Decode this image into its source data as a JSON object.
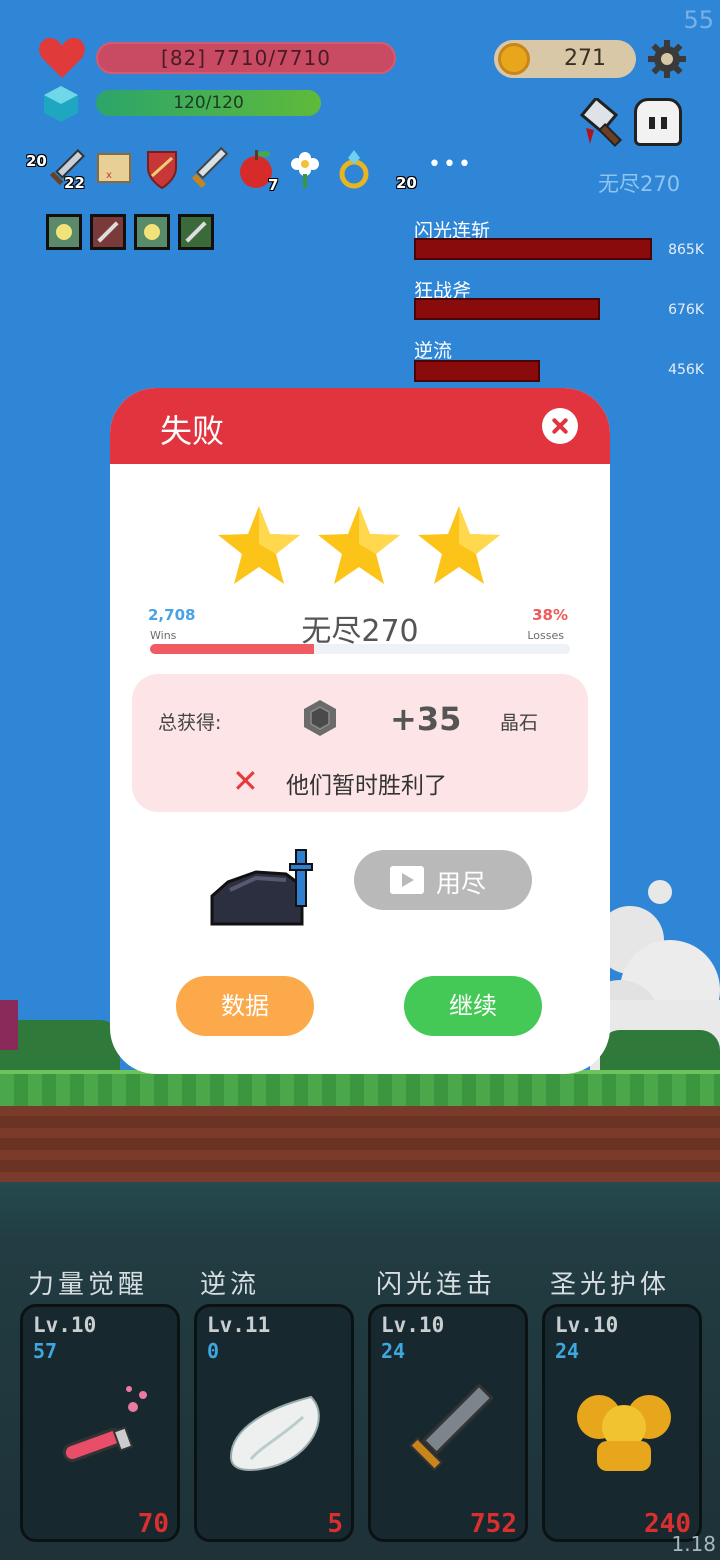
{
  "fps": "55",
  "hud": {
    "hp_text": "[82] 7710/7710",
    "mp_text": "120/120",
    "gold": "271",
    "endless_label": "无尽270"
  },
  "inventory": {
    "counts": [
      "20",
      "22",
      "7",
      "20"
    ],
    "more": "•••"
  },
  "damage_list": [
    {
      "name": "闪光连斩",
      "value": "865K",
      "ratio": 1.0
    },
    {
      "name": "狂战斧",
      "value": "676K",
      "ratio": 0.78
    },
    {
      "name": "逆流",
      "value": "456K",
      "ratio": 0.53
    }
  ],
  "modal": {
    "title": "失败",
    "stars": 3,
    "stage": "无尽270",
    "wins_count": "2,708",
    "wins_label": "Wins",
    "loss_pct": "38%",
    "loss_label": "Losses",
    "win_ratio": 0.39,
    "reward_label": "总获得:",
    "reward_amount": "+35",
    "reward_unit": "晶石",
    "result_msg": "他们暂时胜利了",
    "ad_label": "用尽",
    "btn_data": "数据",
    "btn_continue": "继续"
  },
  "skills": [
    {
      "title": "力量觉醒",
      "level": "Lv.10",
      "num": "57",
      "cost": "70"
    },
    {
      "title": "逆流",
      "level": "Lv.11",
      "num": "0",
      "cost": "5"
    },
    {
      "title": "闪光连击",
      "level": "Lv.10",
      "num": "24",
      "cost": "752"
    },
    {
      "title": "圣光护体",
      "level": "Lv.10",
      "num": "24",
      "cost": "240"
    }
  ],
  "version": "1.18",
  "colors": {
    "header_red": "#e1343f",
    "hp": "#c94a63",
    "continue_green": "#45c956",
    "data_orange": "#fba94a"
  }
}
